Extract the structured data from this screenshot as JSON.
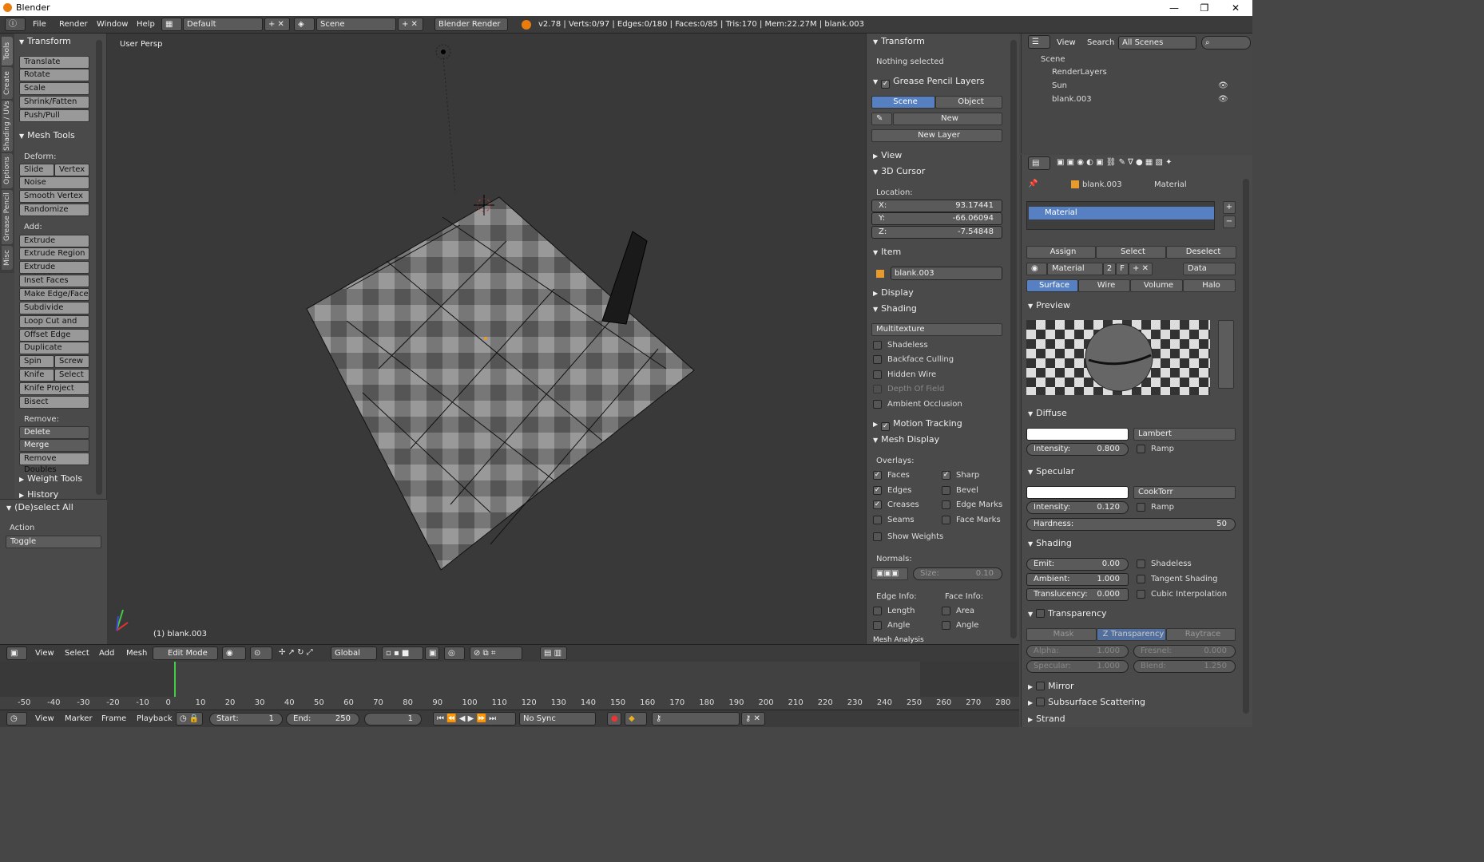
{
  "window": {
    "title": "Blender",
    "min": "—",
    "max": "❐",
    "close": "✕"
  },
  "infobar": {
    "menus": [
      "File",
      "Render",
      "Window",
      "Help"
    ],
    "screen": "Default",
    "scene": "Scene",
    "engine": "Blender Render",
    "stats": "v2.78 | Verts:0/97 | Edges:0/180 | Faces:0/85 | Tris:170 | Mem:22.27M | blank.003"
  },
  "tabs": [
    "Tools",
    "Create",
    "Shading / UVs",
    "Options",
    "Grease Pencil",
    "Misc"
  ],
  "toolshelf": {
    "transform": {
      "title": "Transform",
      "buttons": [
        "Translate",
        "Rotate",
        "Scale",
        "Shrink/Fatten",
        "Push/Pull"
      ]
    },
    "mesh_tools": {
      "title": "Mesh Tools",
      "deform_label": "Deform:",
      "slide_edge": "Slide Ed",
      "vertex": "Vertex",
      "noise": "Noise",
      "smooth_vertex": "Smooth Vertex",
      "randomize": "Randomize",
      "add_label": "Add:",
      "extrude": "Extrude",
      "add_buttons": [
        "Extrude Region",
        "Extrude Individual",
        "Inset Faces",
        "Make Edge/Face",
        "Subdivide",
        "Loop Cut and Slide",
        "Offset Edge Slide",
        "Duplicate"
      ],
      "spin": "Spin",
      "screw": "Screw",
      "knife": "Knife",
      "select": "Select",
      "knife_project": "Knife Project",
      "bisect": "Bisect",
      "remove_label": "Remove:",
      "delete": "Delete",
      "merge": "Merge",
      "remove_doubles": "Remove Doubles"
    },
    "weight_tools": "Weight Tools",
    "history": "History",
    "operator": {
      "title": "(De)select All",
      "action_label": "Action",
      "action_value": "Toggle"
    }
  },
  "viewport": {
    "view_name": "User Persp",
    "object_label": "(1) blank.003"
  },
  "npanel": {
    "transform": {
      "title": "Transform",
      "nothing": "Nothing selected"
    },
    "gp_layers": {
      "title": "Grease Pencil Layers",
      "scene": "Scene",
      "object": "Object",
      "new": "New",
      "new_layer": "New Layer"
    },
    "view": "View",
    "cursor": {
      "title": "3D Cursor",
      "location": "Location:",
      "x_label": "X:",
      "x": "93.17441",
      "y_label": "Y:",
      "y": "-66.06094",
      "z_label": "Z:",
      "z": "-7.54848"
    },
    "item": {
      "title": "Item",
      "name": "blank.003"
    },
    "display": "Display",
    "shading": {
      "title": "Shading",
      "mode": "Multitexture",
      "options": [
        "Shadeless",
        "Backface Culling",
        "Hidden Wire",
        "Depth Of Field",
        "Ambient Occlusion"
      ]
    },
    "motion_tracking": "Motion Tracking",
    "mesh_display": {
      "title": "Mesh Display",
      "overlays": "Overlays:",
      "faces": "Faces",
      "sharp": "Sharp",
      "edges": "Edges",
      "bevel": "Bevel",
      "creases": "Creases",
      "edge_marks": "Edge Marks",
      "seams": "Seams",
      "face_marks": "Face Marks",
      "show_weights": "Show Weights",
      "normals": "Normals:",
      "size_label": "Size:",
      "size": "0.10",
      "edge_info": "Edge Info:",
      "face_info": "Face Info:",
      "length": "Length",
      "area": "Area",
      "angle": "Angle",
      "face_angle": "Angle"
    },
    "mesh_analysis": "Mesh Analysis"
  },
  "outliner": {
    "view": "View",
    "search": "Search",
    "filter": "All Scenes",
    "items": [
      "Scene",
      "RenderLayers",
      "Sun",
      "blank.003"
    ]
  },
  "properties": {
    "breadcrumb": [
      "blank.003",
      "Material"
    ],
    "slot": "Material",
    "assign": "Assign",
    "select": "Select",
    "deselect": "Deselect",
    "material_name": "Material",
    "users": "2",
    "fake": "F",
    "link": "Data",
    "tabs": [
      "Surface",
      "Wire",
      "Volume",
      "Halo"
    ],
    "preview": "Preview",
    "diffuse": {
      "title": "Diffuse",
      "shader": "Lambert",
      "intensity_label": "Intensity:",
      "intensity": "0.800",
      "ramp": "Ramp"
    },
    "specular": {
      "title": "Specular",
      "shader": "CookTorr",
      "intensity_label": "Intensity:",
      "intensity": "0.120",
      "ramp": "Ramp",
      "hardness_label": "Hardness:",
      "hardness": "50"
    },
    "shading": {
      "title": "Shading",
      "emit_label": "Emit:",
      "emit": "0.00",
      "ambient_label": "Ambient:",
      "ambient": "1.000",
      "translucency_label": "Translucency:",
      "translucency": "0.000",
      "shadeless": "Shadeless",
      "tangent": "Tangent Shading",
      "cubic": "Cubic Interpolation"
    },
    "transparency": {
      "title": "Transparency",
      "tabs": [
        "Mask",
        "Z Transparency",
        "Raytrace"
      ],
      "alpha_label": "Alpha:",
      "alpha": "1.000",
      "fresnel_label": "Fresnel:",
      "fresnel": "0.000",
      "specular_label": "Specular:",
      "specular": "1.000",
      "blend_label": "Blend:",
      "blend": "1.250"
    },
    "mirror": "Mirror",
    "sss": "Subsurface Scattering",
    "strand": "Strand"
  },
  "view3d_header": {
    "menus": [
      "View",
      "Select",
      "Add",
      "Mesh"
    ],
    "mode": "Edit Mode",
    "orientation": "Global"
  },
  "timeline": {
    "ticks": [
      "-50",
      "-40",
      "-30",
      "-20",
      "-10",
      "0",
      "10",
      "20",
      "30",
      "40",
      "50",
      "60",
      "70",
      "80",
      "90",
      "100",
      "110",
      "120",
      "130",
      "140",
      "150",
      "160",
      "170",
      "180",
      "190",
      "200",
      "210",
      "220",
      "230",
      "240",
      "250",
      "260",
      "270",
      "280"
    ]
  },
  "timeline_header": {
    "menus": [
      "View",
      "Marker",
      "Frame",
      "Playback"
    ],
    "start_label": "Start:",
    "start": "1",
    "end_label": "End:",
    "end": "250",
    "current": "1",
    "sync": "No Sync"
  }
}
